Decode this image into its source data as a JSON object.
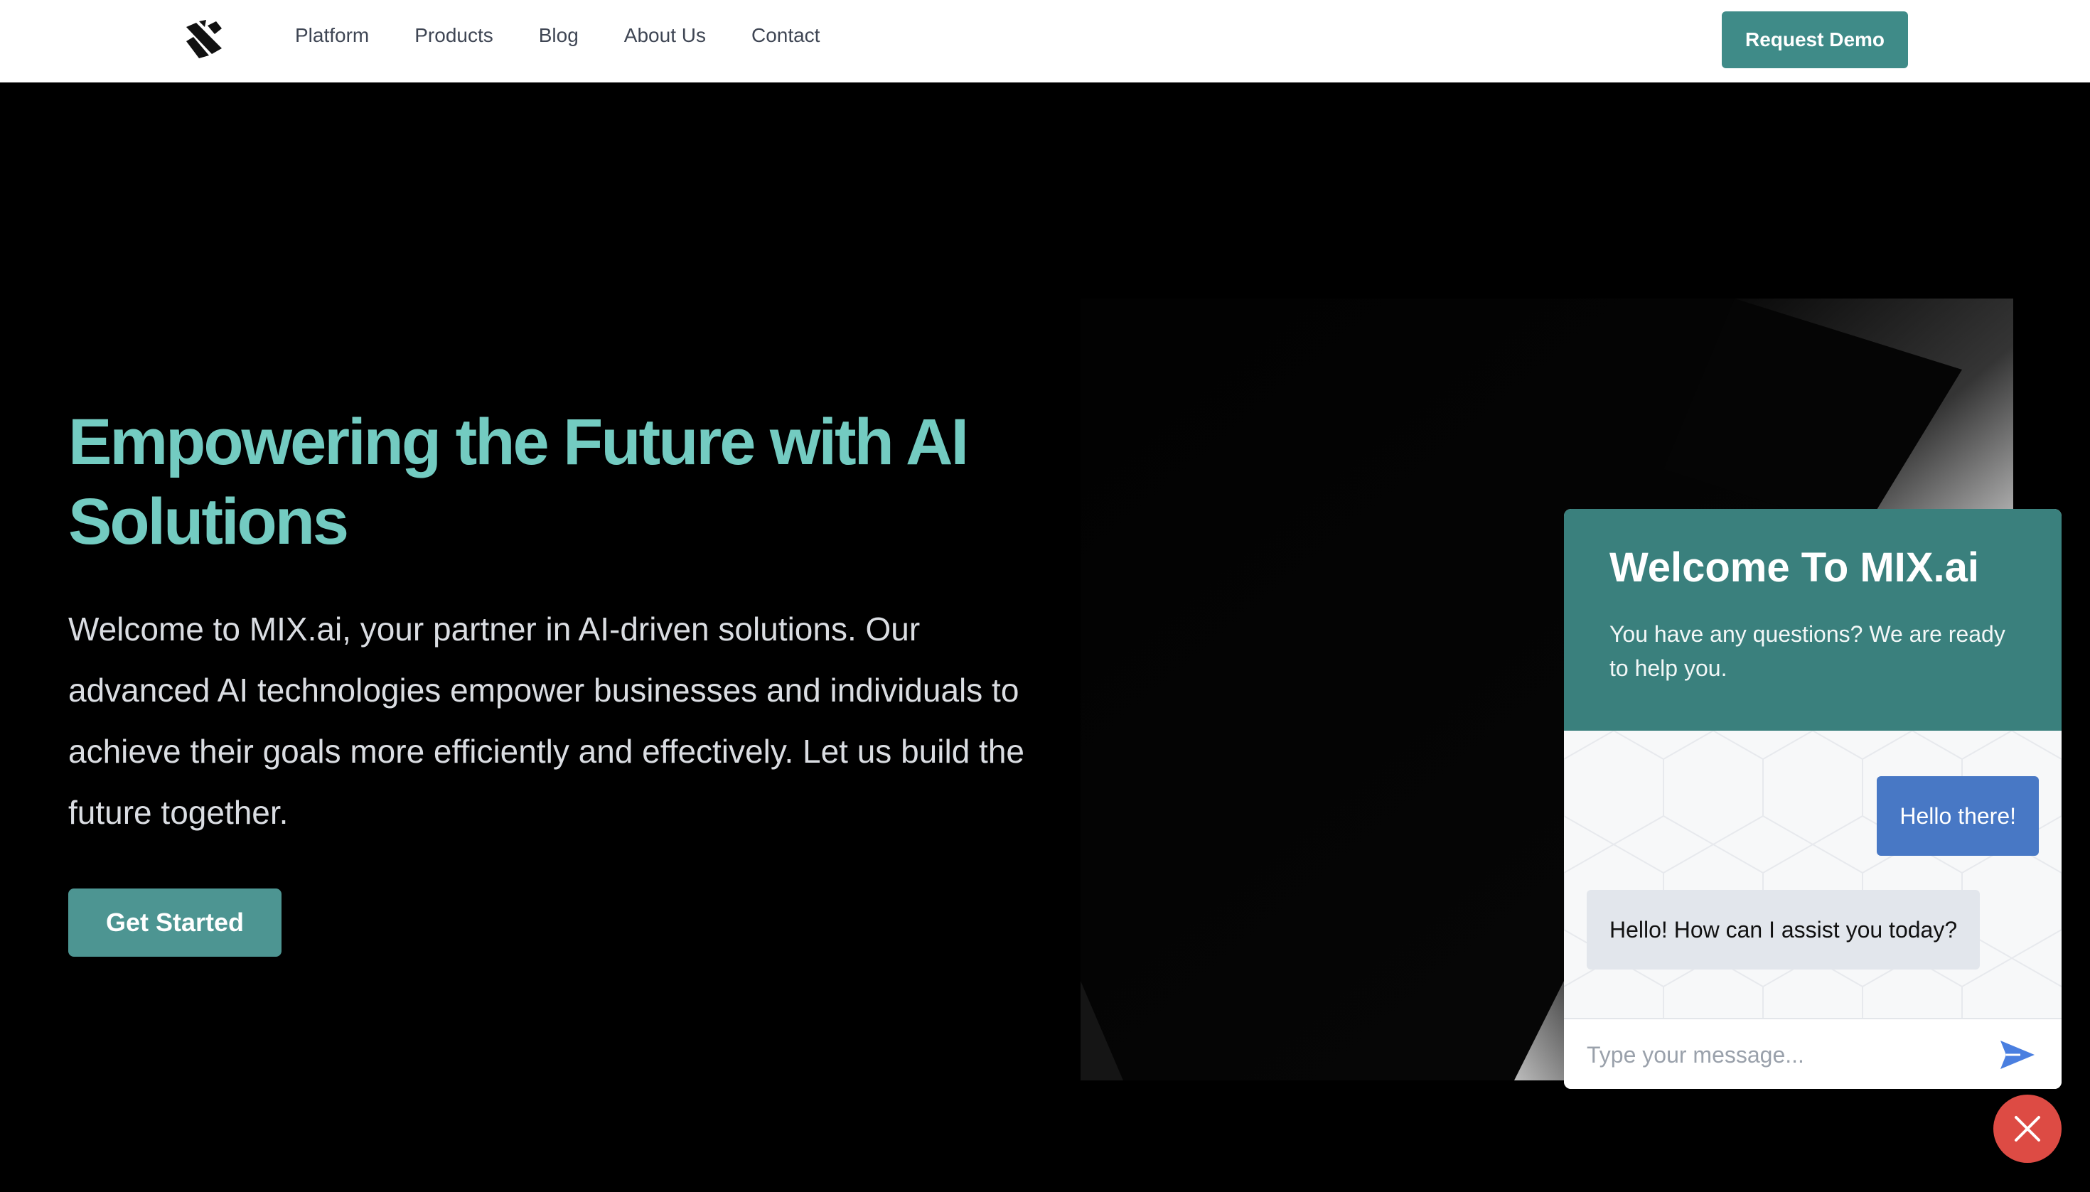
{
  "header": {
    "logo_icon": "mix-logo-icon",
    "nav": [
      {
        "label": "Platform"
      },
      {
        "label": "Products"
      },
      {
        "label": "Blog"
      },
      {
        "label": "About Us"
      },
      {
        "label": "Contact"
      }
    ],
    "cta_label": "Request Demo"
  },
  "hero": {
    "title": "Empowering the Future with AI Solutions",
    "description": "Welcome to MIX.ai, your partner in AI-driven solutions. Our advanced AI technologies empower businesses and individuals to achieve their goals more efficiently and effectively. Let us build the future together.",
    "cta_label": "Get Started"
  },
  "chat": {
    "title": "Welcome To MIX.ai",
    "subtitle": "You have any questions? We are ready to help you.",
    "messages": [
      {
        "from": "user",
        "text": "Hello there!"
      },
      {
        "from": "bot",
        "text": "Hello! How can I assist you today?"
      }
    ],
    "input_placeholder": "Type your message...",
    "send_icon": "send-icon",
    "close_icon": "close-icon"
  },
  "colors": {
    "accent": "#3f8b88",
    "hero_title": "#73cbc1",
    "chat_header": "#3a807d",
    "user_bubble": "#4878c5",
    "bot_bubble": "#e2e6ec",
    "close_button": "#dd4b44"
  }
}
